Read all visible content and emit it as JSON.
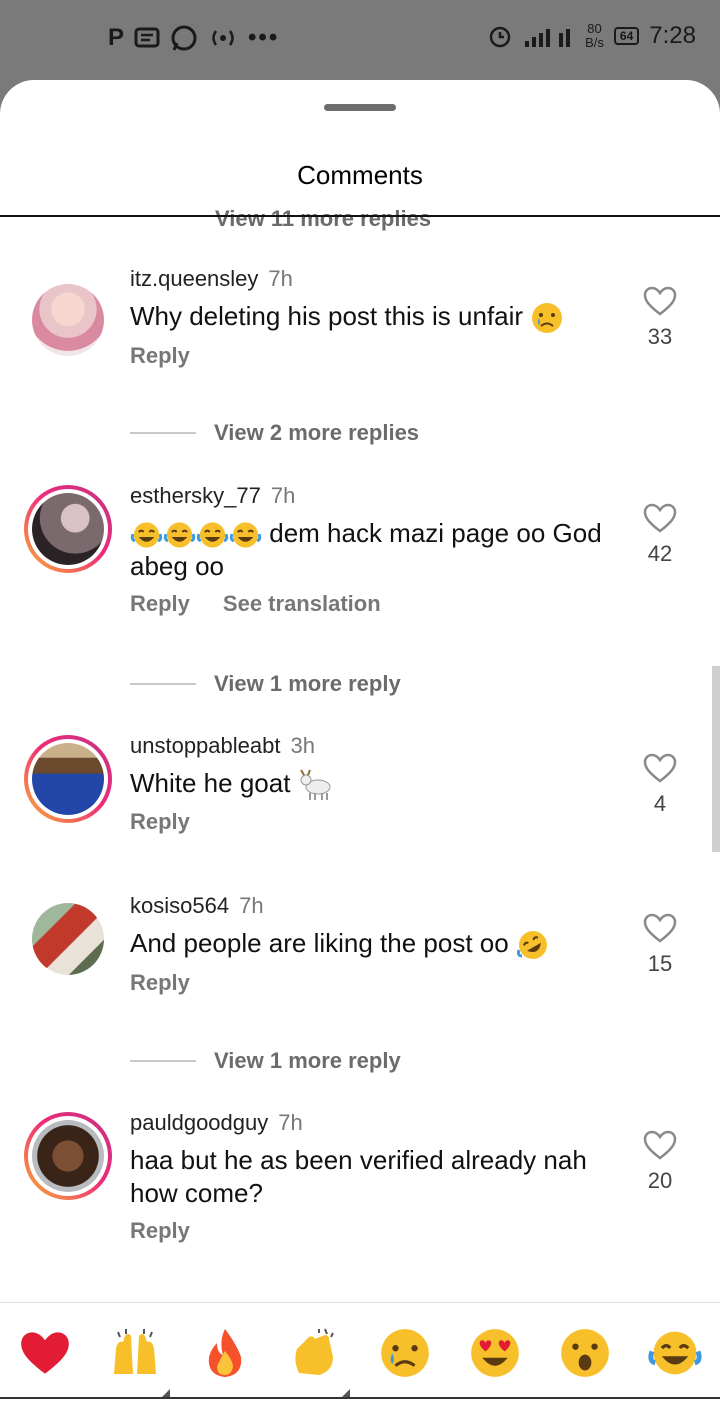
{
  "status_bar": {
    "left_icons": [
      "p-icon",
      "message-icon",
      "whatsapp-icon",
      "hotspot-icon",
      "more-dots"
    ],
    "network": "4G",
    "speed": "80",
    "speed_unit": "B/s",
    "battery": "64",
    "time": "7:28"
  },
  "sheet": {
    "title": "Comments",
    "clipped_top_text": "View 11 more replies"
  },
  "comments": [
    {
      "username": "itz.queensley",
      "time": "7h",
      "text": "Why deleting his post this is unfair",
      "emoji": "sad-tear-emoji",
      "actions": [
        "Reply"
      ],
      "likes": "33"
    },
    {
      "username": "esthersky_77",
      "time": "7h",
      "text": "dem hack mazi page oo God abeg oo",
      "emoji_prefix": [
        "laugh-cry-emoji",
        "laugh-cry-emoji",
        "laugh-cry-emoji",
        "laugh-cry-emoji"
      ],
      "actions": [
        "Reply",
        "See translation"
      ],
      "likes": "42"
    },
    {
      "username": "unstoppableabt",
      "time": "3h",
      "text": "White he goat",
      "emoji": "goat-emoji",
      "actions": [
        "Reply"
      ],
      "likes": "4"
    },
    {
      "username": "kosiso564",
      "time": "7h",
      "text": "And people are liking the post oo",
      "emoji": "rofl-emoji",
      "actions": [
        "Reply"
      ],
      "likes": "15"
    },
    {
      "username": "pauldgoodguy",
      "time": "7h",
      "text": "haa but he as been verified already nah how come?",
      "actions": [
        "Reply"
      ],
      "likes": "20"
    }
  ],
  "view_replies": [
    "View 2 more replies",
    "View 1 more reply",
    "View 1 more reply"
  ],
  "reactions": [
    "red-heart",
    "raising-hands",
    "fire",
    "clapping-hands",
    "sad-tear",
    "heart-eyes",
    "astonished",
    "laugh-cry"
  ],
  "colors": {
    "story_ring_start": "#f9b233",
    "story_ring_end": "#c13584",
    "heart": "#e21c34",
    "status_bar_bg": "#7a7a7a"
  }
}
